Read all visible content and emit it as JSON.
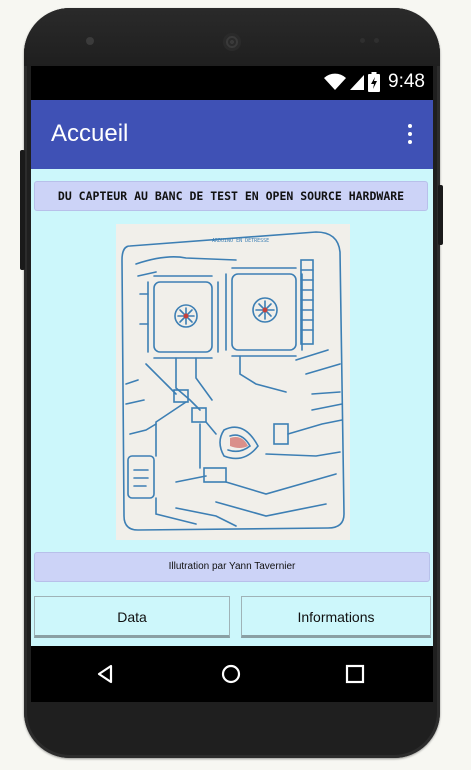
{
  "statusbar": {
    "time": "9:48",
    "icons": [
      "wifi-icon",
      "signal-icon",
      "battery-charging-icon"
    ]
  },
  "appbar": {
    "title": "Accueil",
    "menu_icon": "overflow-menu-icon"
  },
  "headline": {
    "text": "DU CAPTEUR AU BANC DE TEST EN OPEN SOURCE HARDWARE"
  },
  "illustration": {
    "label": "ARDUINO EN DÉTRESSE"
  },
  "caption": {
    "text": "Illutration par Yann Tavernier"
  },
  "buttons": {
    "data_label": "Data",
    "info_label": "Informations"
  },
  "navbar": {
    "icons": [
      "back-icon",
      "home-icon",
      "recents-icon"
    ]
  },
  "colors": {
    "appbar": "#3f51b5",
    "screen_bg": "#ccf7fb",
    "label_bg": "#ccd3f7"
  }
}
